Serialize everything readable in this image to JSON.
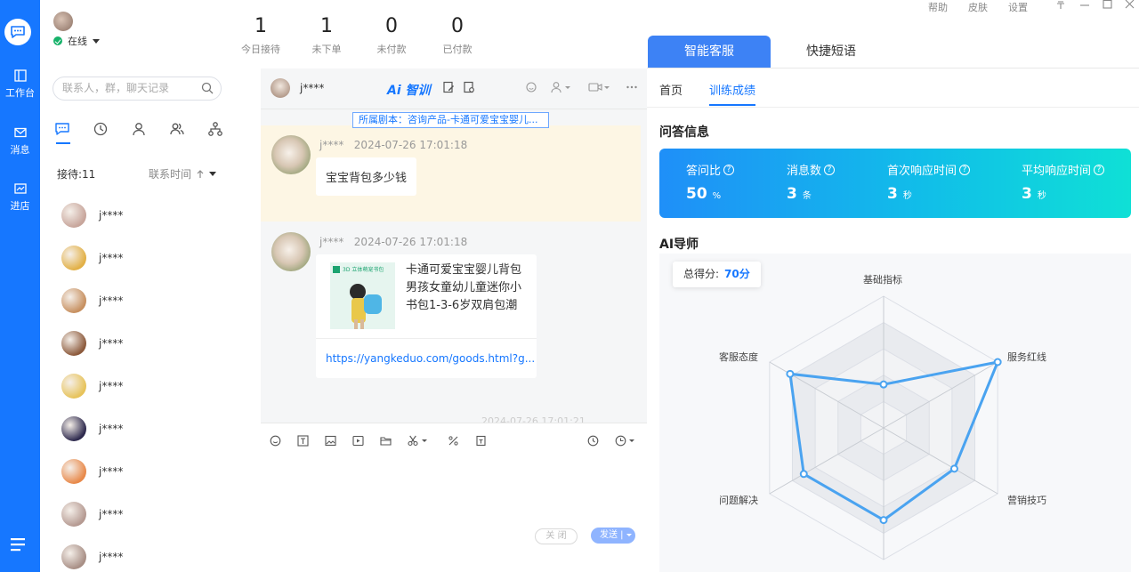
{
  "rail": {
    "items": [
      {
        "label": "工作台",
        "icon": "workbench-icon"
      },
      {
        "label": "消息",
        "icon": "mail-icon"
      },
      {
        "label": "进店",
        "icon": "store-icon"
      }
    ]
  },
  "user": {
    "status": "在线"
  },
  "stats": [
    {
      "value": "1",
      "label": "今日接待"
    },
    {
      "value": "1",
      "label": "未下单"
    },
    {
      "value": "0",
      "label": "未付款"
    },
    {
      "value": "0",
      "label": "已付款"
    }
  ],
  "contacts": {
    "search_placeholder": "联系人，群，聊天记录",
    "reception_count": "接待:11",
    "sort_label": "联系时间",
    "items": [
      {
        "name": "j****",
        "color": "#c7a59b"
      },
      {
        "name": "j****",
        "color": "#e2b046"
      },
      {
        "name": "j****",
        "color": "#c79060"
      },
      {
        "name": "j****",
        "color": "#8c5a3c"
      },
      {
        "name": "j****",
        "color": "#e7c35a"
      },
      {
        "name": "j****",
        "color": "#2e2a4e"
      },
      {
        "name": "j****",
        "color": "#e8894a"
      },
      {
        "name": "j****",
        "color": "#b59a92"
      },
      {
        "name": "j****",
        "color": "#a88f86"
      }
    ]
  },
  "chat": {
    "header_name": "j****",
    "ai_label": "Ai 智训",
    "script_tag": "所属剧本：咨询产品-卡通可爱宝宝婴儿...",
    "messages": [
      {
        "sender": "j****",
        "time": "2024-07-26 17:01:18",
        "text": "宝宝背包多少钱"
      },
      {
        "sender": "j****",
        "time": "2024-07-26 17:01:18"
      }
    ],
    "product": {
      "title": "卡通可爱宝宝婴儿背包男孩女童幼儿童迷你小书包1-3-6岁双肩包潮",
      "image_text": "3D 立体萌宠书包",
      "link": "https://yangkeduo.com/goods.html?g..."
    },
    "faded_time": "2024-07-26 17:01:21",
    "close_label": "关 闭",
    "send_label": "发送 |"
  },
  "panel": {
    "window_controls": [
      "帮助",
      "皮肤",
      "设置"
    ],
    "tabs": [
      "智能客服",
      "快捷短语"
    ],
    "subtabs": [
      "首页",
      "训练成绩"
    ],
    "qa_title": "问答信息",
    "metrics": [
      {
        "label": "答问比",
        "value": "50",
        "unit": "%"
      },
      {
        "label": "消息数",
        "value": "3",
        "unit": "条"
      },
      {
        "label": "首次响应时间",
        "value": "3",
        "unit": "秒"
      },
      {
        "label": "平均响应时间",
        "value": "3",
        "unit": "秒"
      }
    ],
    "mentor_title": "AI导师",
    "score_label": "总得分:",
    "score_value": "70分"
  },
  "radar": {
    "axes": [
      "基础指标",
      "服务红线",
      "营销技巧",
      "问题解决",
      "客服态度"
    ],
    "values": [
      0.33,
      1.0,
      0.62,
      0.7,
      0.7,
      0.82
    ],
    "line_color": "#4aa3f0"
  }
}
